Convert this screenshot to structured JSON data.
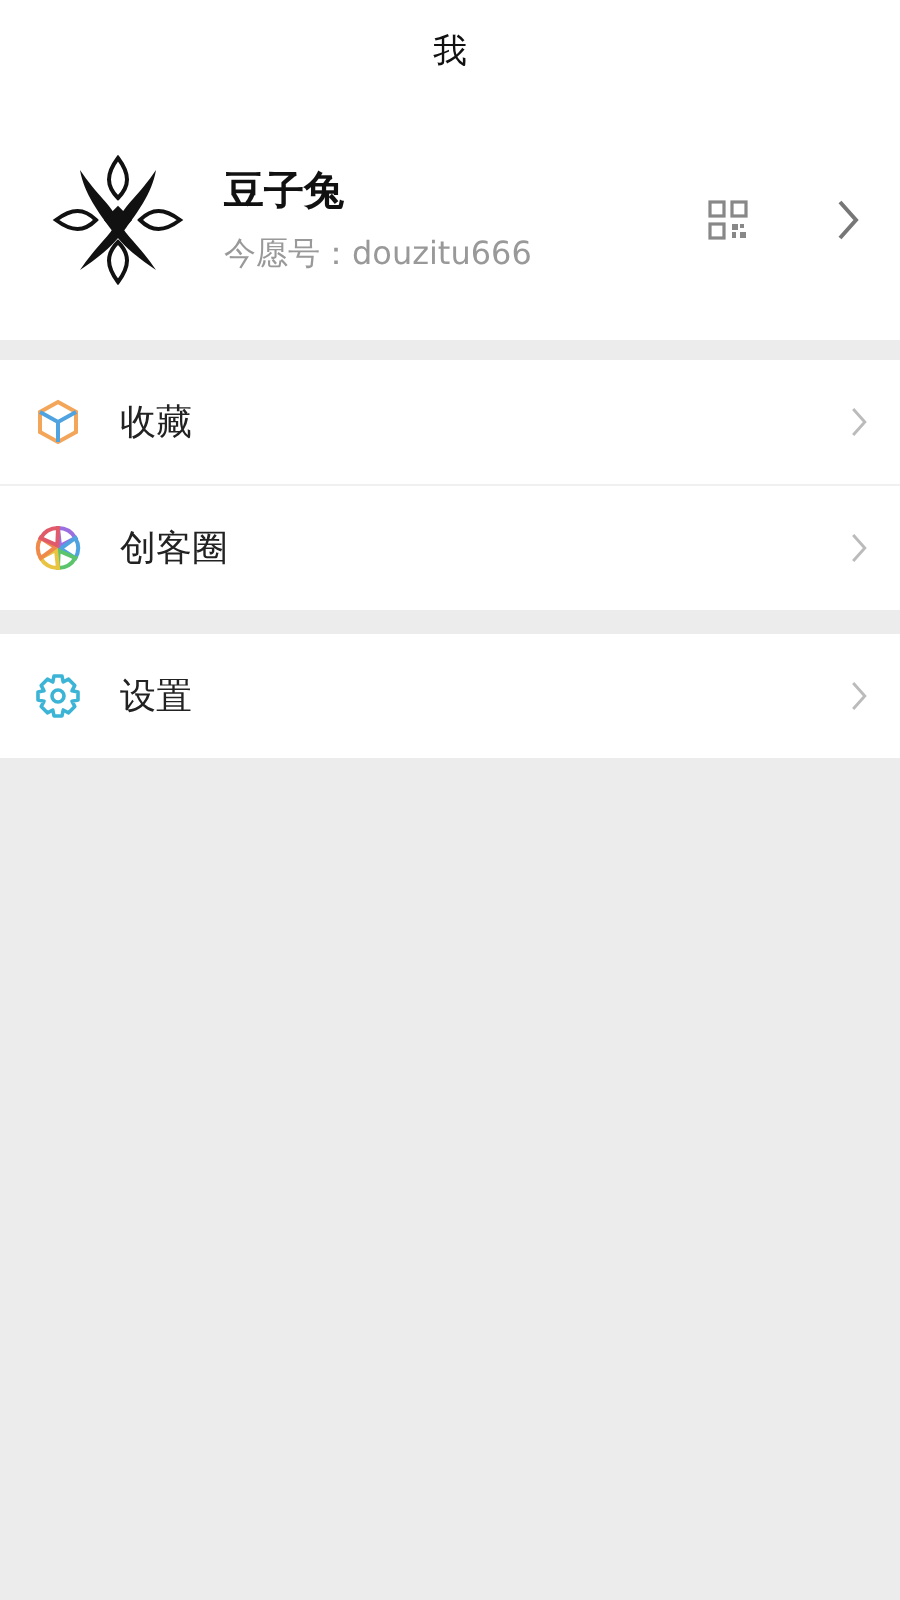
{
  "header": {
    "title": "我"
  },
  "profile": {
    "name": "豆子兔",
    "account": "今愿号：douzitu666"
  },
  "menu_groups": [
    {
      "items": [
        {
          "label": "收藏",
          "kind": "box"
        },
        {
          "label": "创客圈",
          "kind": "aperture"
        }
      ]
    },
    {
      "items": [
        {
          "label": "设置",
          "kind": "gear"
        }
      ]
    }
  ]
}
